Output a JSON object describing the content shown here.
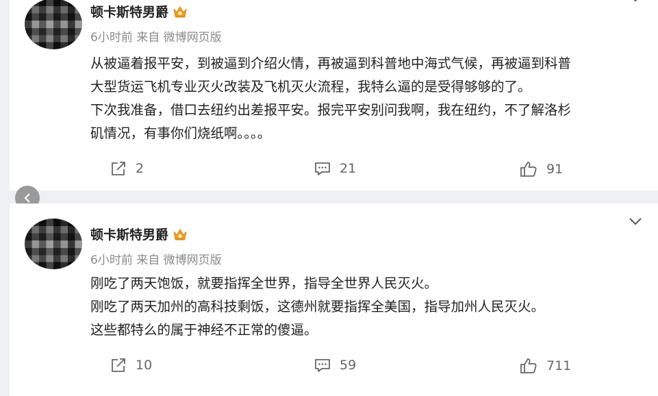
{
  "posts": [
    {
      "username": "顿卡斯特男爵",
      "meta": "6小时前 来自 微博网页版",
      "lines": [
        "从被逼着报平安，到被逼到介绍火情，再被逼到科普地中海式气候，再被逼到科普",
        "大型货运飞机专业灭火改装及飞机灭火流程，我特么逼的是受得够够的了。",
        "下次我准备，借口去纽约出差报平安。报完平安别问我啊，我在纽约，不了解洛杉",
        "矶情况，有事你们烧纸啊。。。。"
      ],
      "shares": "2",
      "comments": "21",
      "likes": "91"
    },
    {
      "username": "顿卡斯特男爵",
      "meta": "6小时前 来自 微博网页版",
      "lines": [
        "刚吃了两天饱饭，就要指挥全世界，指导全世界人民灭火。",
        "刚吃了两天加州的高科技剩饭，这德州就要指挥全美国，指导加州人民灭火。",
        "这些都特么的属于神经不正常的傻逼。"
      ],
      "shares": "10",
      "comments": "59",
      "likes": "711"
    }
  ],
  "icons": {
    "share": "share-icon",
    "comment": "comment-icon",
    "like": "thumbs-up-icon",
    "badge": "crown-badge-icon",
    "more": "chevron-down-icon",
    "back": "chevron-left-icon"
  },
  "colors": {
    "background": "#eef0f3",
    "card": "#ffffff",
    "text": "#222222",
    "meta": "#8a8a8a",
    "badge": "#f0a020"
  }
}
